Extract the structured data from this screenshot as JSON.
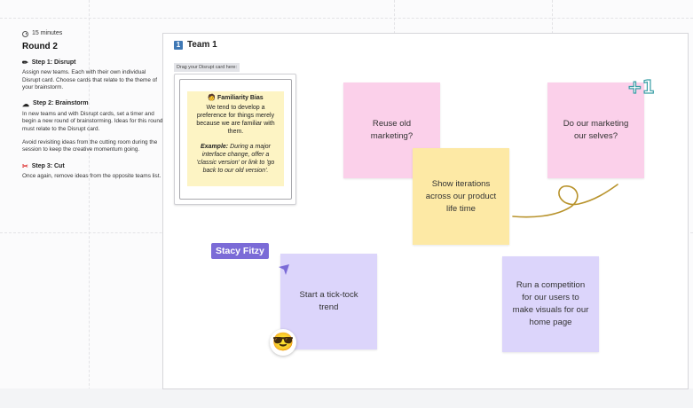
{
  "instructions": {
    "timer": "15 minutes",
    "round_title": "Round 2",
    "steps": [
      {
        "title": "Step 1: Disrupt",
        "icon": "pencil-icon",
        "paragraphs": [
          "Assign new teams. Each with their own individual Disrupt card. Choose cards that relate to the theme of your brainstorm."
        ]
      },
      {
        "title": "Step 2: Brainstorm",
        "icon": "cloud-icon",
        "paragraphs": [
          "In new teams and with Disrupt cards, set a timer and begin a new round of brainstorming. Ideas for this round must relate to the Disrupt card.",
          "Avoid revisiting ideas from the cutting room during the session to keep the creative momentum going."
        ]
      },
      {
        "title": "Step 3: Cut",
        "icon": "scissors-icon",
        "paragraphs": [
          "Once again, remove ideas from the opposite teams list."
        ]
      }
    ]
  },
  "frame": {
    "badge": "1",
    "title": "Team 1",
    "drag_label": "Drag your Disrupt card here:",
    "disrupt_card": {
      "title": "Familiarity Bias",
      "body": "We tend to develop a preference for things merely because we are familiar with them.",
      "example_label": "Example:",
      "example_text": "During a major interface change, offer a 'classic version' or link to 'go back to our old version'."
    }
  },
  "stickies": [
    {
      "text": "Reuse old marketing?",
      "color": "#fbd0ea"
    },
    {
      "text": "Show iterations across our product life time",
      "color": "#fde9a5"
    },
    {
      "text": "Do our marketing our selves?",
      "color": "#fbd0ea"
    },
    {
      "text": "Start a tick-tock trend",
      "color": "#dcd5fb"
    },
    {
      "text": "Run a competition for our users to make visuals for our home page",
      "color": "#dcd5fb"
    }
  ],
  "collaborator": {
    "name": "Stacy Fitzy",
    "color": "#7b6bd7"
  },
  "reactions": {
    "emoji": "😎",
    "plus_one": "+1"
  }
}
